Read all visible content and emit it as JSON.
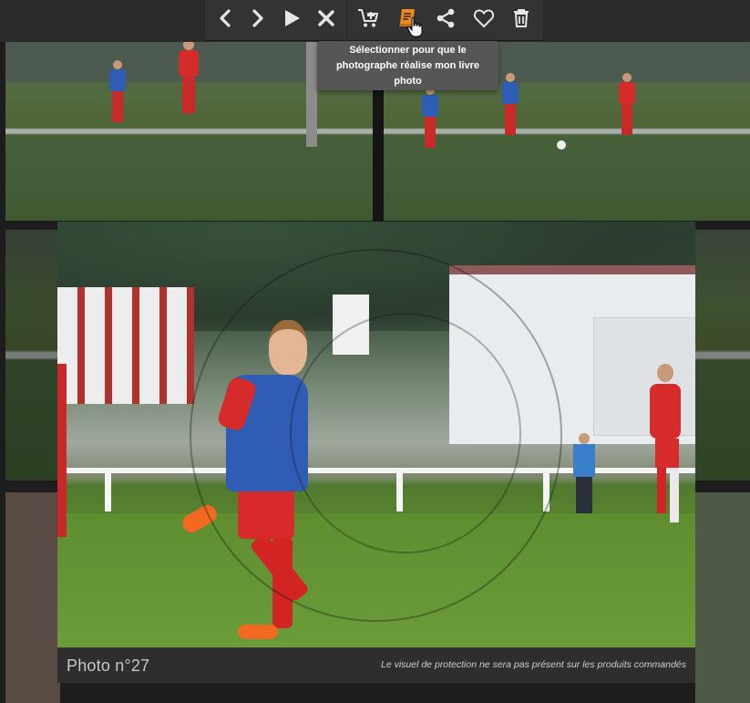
{
  "toolbar": {
    "nav_buttons": [
      {
        "icon": "chevron-left-icon",
        "label": "Previous"
      },
      {
        "icon": "chevron-right-icon",
        "label": "Next"
      },
      {
        "icon": "play-icon",
        "label": "Slideshow"
      },
      {
        "icon": "close-icon",
        "label": "Close"
      }
    ],
    "action_buttons": [
      {
        "icon": "add-to-cart-icon"
      },
      {
        "icon": "photobook-icon",
        "active": true,
        "active_color": "#f08a1c"
      },
      {
        "icon": "share-icon"
      },
      {
        "icon": "heart-icon"
      },
      {
        "icon": "trash-icon"
      }
    ]
  },
  "tooltip": {
    "line1": "Sélectionner pour que le",
    "line2": "photographe réalise mon livre",
    "line3": "photo"
  },
  "caption": {
    "photo_number": "Photo n°27",
    "protection_note": "Le visuel de protection ne sera pas présent sur les produits commandés"
  },
  "colors": {
    "toolbar_bg": "#333333",
    "icon_color": "#e6e6e6",
    "accent": "#f08a1c",
    "caption_bg": "#2e2e2e"
  }
}
